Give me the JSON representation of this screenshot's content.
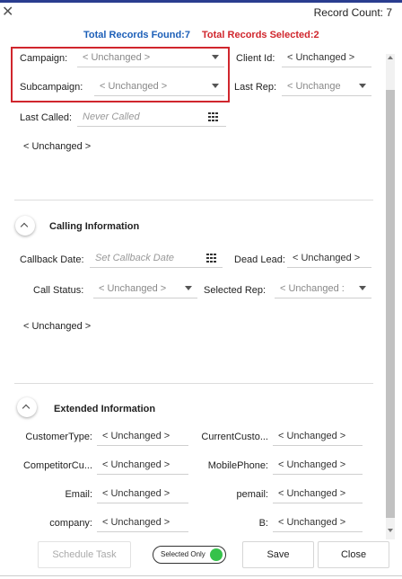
{
  "header": {
    "close_icon": "close-icon",
    "record_count": "Record Count:  7"
  },
  "totals": {
    "found": "Total Records Found:7",
    "selected": "Total Records Selected:2"
  },
  "fields": {
    "campaign": {
      "label": "Campaign:",
      "value": "< Unchanged >"
    },
    "subcampaign": {
      "label": "Subcampaign:",
      "value": "< Unchanged >"
    },
    "client_id": {
      "label": "Client Id:",
      "value": "< Unchanged >"
    },
    "last_rep": {
      "label": "Last Rep:",
      "value": "< Unchange"
    },
    "last_called": {
      "label": "Last Called:",
      "placeholder": "Never Called"
    },
    "notes_value": "< Unchanged >"
  },
  "calling": {
    "title": "Calling Information",
    "callback_date": {
      "label": "Callback Date:",
      "placeholder": "Set Callback Date"
    },
    "dead_lead": {
      "label": "Dead Lead:",
      "value": "< Unchanged >"
    },
    "call_status": {
      "label": "Call Status:",
      "value": "< Unchanged >"
    },
    "selected_rep": {
      "label": "Selected Rep:",
      "value": "< Unchanged :"
    },
    "notes_value": "< Unchanged >"
  },
  "extended": {
    "title": "Extended Information",
    "rows": [
      {
        "left_label": "CustomerType:",
        "left_value": "< Unchanged >",
        "right_label": "CurrentCusto...",
        "right_value": "< Unchanged >"
      },
      {
        "left_label": "CompetitorCu...",
        "left_value": "< Unchanged >",
        "right_label": "MobilePhone:",
        "right_value": "< Unchanged >"
      },
      {
        "left_label": "Email:",
        "left_value": "< Unchanged >",
        "right_label": "pemail:",
        "right_value": "< Unchanged >"
      },
      {
        "left_label": "company:",
        "left_value": "< Unchanged >",
        "right_label": "B:",
        "right_value": "< Unchanged >"
      }
    ]
  },
  "footer": {
    "schedule_task": "Schedule Task",
    "selected_only": "Selected Only",
    "save": "Save",
    "close": "Close"
  },
  "colors": {
    "found": "#1c5fb8",
    "selected": "#d0262d",
    "toggle_on": "#35c24a",
    "topbar": "#2a3d8f"
  }
}
